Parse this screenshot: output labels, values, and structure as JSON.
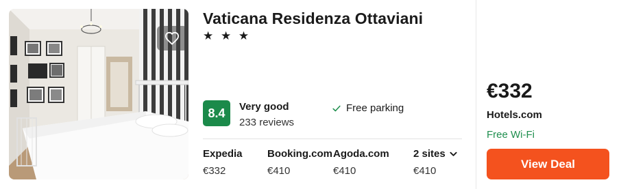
{
  "hotel": {
    "name": "Vaticana Residenza Ottaviani",
    "stars": "★ ★ ★",
    "star_count": 3
  },
  "rating": {
    "score": "8.4",
    "label": "Very good",
    "reviews": "233 reviews",
    "color": "#1b8a4a"
  },
  "amenities": [
    {
      "icon": "check-icon",
      "label": "Free parking"
    }
  ],
  "sites": [
    {
      "name": "Expedia",
      "price": "€332"
    },
    {
      "name": "Booking.com",
      "price": "€410"
    },
    {
      "name": "Agoda.com",
      "price": "€410"
    },
    {
      "name": "2 sites",
      "price": "€410",
      "icon": "chevron-down-icon"
    }
  ],
  "deal": {
    "price": "€332",
    "provider": "Hotels.com",
    "perk": "Free Wi-Fi",
    "perk_color": "#1f8f4e",
    "button_label": "View Deal",
    "button_color": "#f4521e"
  },
  "photo": {
    "icon": "heart-icon"
  }
}
